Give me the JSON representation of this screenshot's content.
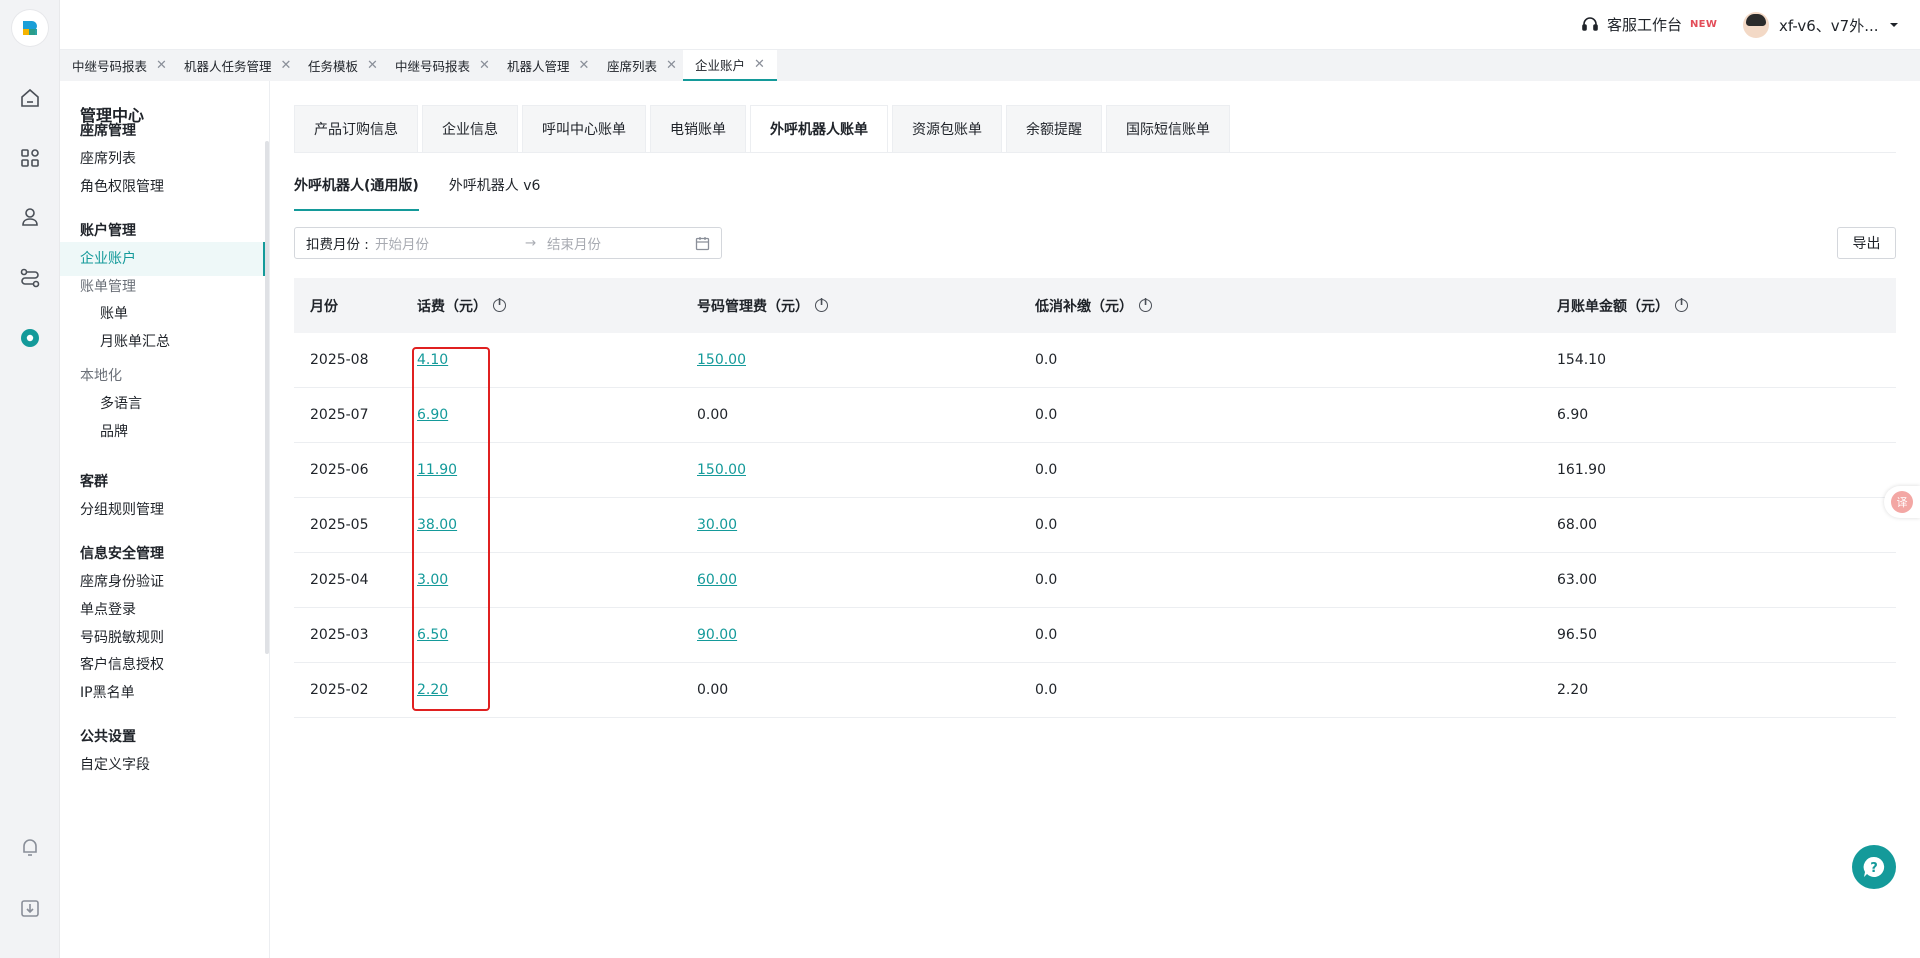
{
  "brand": {
    "accent": "#149a9a",
    "highlight_box": "#e02020"
  },
  "header": {
    "service_label": "客服工作台",
    "service_badge": "NEW",
    "user_name": "xf-v6、v7外..."
  },
  "page_tabs": [
    {
      "label": "中继号码报表",
      "active": false
    },
    {
      "label": "机器人任务管理",
      "active": false
    },
    {
      "label": "任务模板",
      "active": false
    },
    {
      "label": "中继号码报表",
      "active": false
    },
    {
      "label": "机器人管理",
      "active": false
    },
    {
      "label": "座席列表",
      "active": false
    },
    {
      "label": "企业账户",
      "active": true
    }
  ],
  "sidebar": {
    "title": "管理中心",
    "groups": {
      "seat": "座席管理",
      "seat_list": "座席列表",
      "role_perm": "角色权限管理",
      "account": "账户管理",
      "enterprise_account": "企业账户",
      "bill_mgmt": "账单管理",
      "bill": "账单",
      "monthly_summary": "月账单汇总",
      "localization": "本地化",
      "multi_lang": "多语言",
      "brand": "品牌",
      "customer_group": "客群",
      "group_rules": "分组规则管理",
      "info_security": "信息安全管理",
      "seat_auth": "座席身份验证",
      "sso": "单点登录",
      "number_mask": "号码脱敏规则",
      "customer_auth": "客户信息授权",
      "ip_blacklist": "IP黑名单",
      "public_settings": "公共设置",
      "custom_fields": "自定义字段"
    }
  },
  "main": {
    "tabs": [
      {
        "label": "产品订购信息",
        "active": false
      },
      {
        "label": "企业信息",
        "active": false
      },
      {
        "label": "呼叫中心账单",
        "active": false
      },
      {
        "label": "电销账单",
        "active": false
      },
      {
        "label": "外呼机器人账单",
        "active": true
      },
      {
        "label": "资源包账单",
        "active": false
      },
      {
        "label": "余额提醒",
        "active": false
      },
      {
        "label": "国际短信账单",
        "active": false
      }
    ],
    "subtabs": [
      {
        "label": "外呼机器人(通用版)",
        "active": true
      },
      {
        "label": "外呼机器人 v6",
        "active": false
      }
    ],
    "filter": {
      "label": "扣费月份 :",
      "start_placeholder": "开始月份",
      "separator": "→",
      "end_placeholder": "结束月份"
    },
    "export_label": "导出",
    "table": {
      "headers": {
        "month": "月份",
        "call_fee": "话费（元）",
        "number_fee": "号码管理费（元）",
        "min_fee": "低消补缴（元）",
        "total": "月账单金额（元）"
      },
      "rows": [
        {
          "month": "2025-08",
          "call_fee": "4.10",
          "number_fee": "150.00",
          "number_fee_link": true,
          "min_fee": "0.0",
          "total": "154.10"
        },
        {
          "month": "2025-07",
          "call_fee": "6.90",
          "number_fee": "0.00",
          "number_fee_link": false,
          "min_fee": "0.0",
          "total": "6.90"
        },
        {
          "month": "2025-06",
          "call_fee": "11.90",
          "number_fee": "150.00",
          "number_fee_link": true,
          "min_fee": "0.0",
          "total": "161.90"
        },
        {
          "month": "2025-05",
          "call_fee": "38.00",
          "number_fee": "30.00",
          "number_fee_link": true,
          "min_fee": "0.0",
          "total": "68.00"
        },
        {
          "month": "2025-04",
          "call_fee": "3.00",
          "number_fee": "60.00",
          "number_fee_link": true,
          "min_fee": "0.0",
          "total": "63.00"
        },
        {
          "month": "2025-03",
          "call_fee": "6.50",
          "number_fee": "90.00",
          "number_fee_link": true,
          "min_fee": "0.0",
          "total": "96.50"
        },
        {
          "month": "2025-02",
          "call_fee": "2.20",
          "number_fee": "0.00",
          "number_fee_link": false,
          "min_fee": "0.0",
          "total": "2.20"
        }
      ]
    }
  }
}
